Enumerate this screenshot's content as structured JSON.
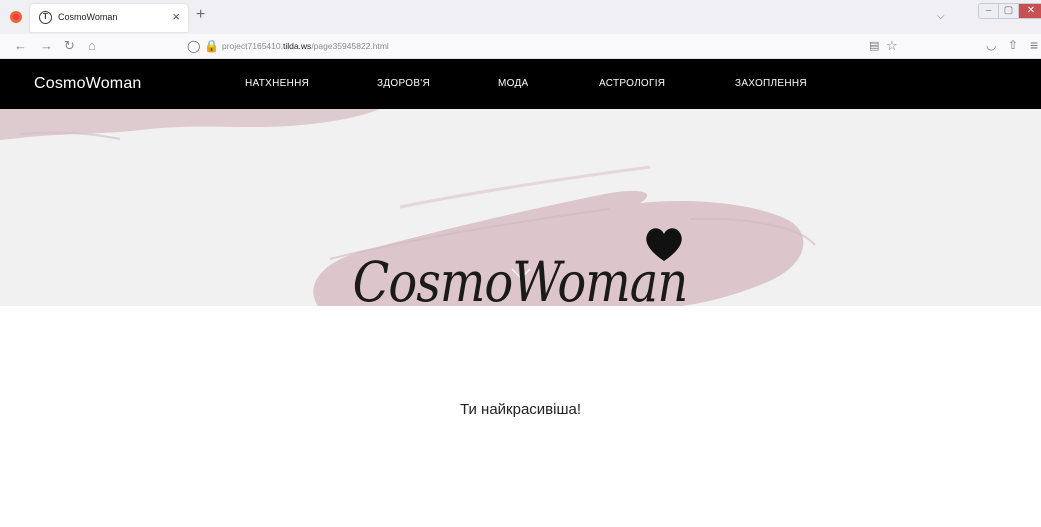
{
  "browser": {
    "tab_title": "CosmoWoman",
    "tab_favicon_glyph": "T",
    "tab_close_glyph": "×",
    "new_tab_glyph": "+",
    "tabs_menu_glyph": "⌵",
    "url_prefix": "project7165410.",
    "url_host": "tilda.ws",
    "url_path": "/page35945822.html",
    "icons": {
      "back": "←",
      "forward": "→",
      "reload": "↻",
      "home": "⌂",
      "shield": "◯",
      "lock": "🔒",
      "reader": "▤",
      "star": "☆",
      "pocket": "◡",
      "extensions": "⇧",
      "menu": "≡"
    },
    "window_controls": {
      "minimize": "–",
      "maximize": "▢",
      "close": "✕"
    }
  },
  "site": {
    "logo": "CosmoWoman",
    "menu": [
      "НАТХНЕННЯ",
      "ЗДОРОВ'Я",
      "МОДА",
      "АСТРОЛОГІЯ",
      "ЗАХОПЛЕННЯ"
    ],
    "hero_script": "CosmoWoman",
    "heart_icon": "heart-icon",
    "headline": "Ти найкрасивіша!"
  },
  "colors": {
    "header_bg": "#000000",
    "hero_bg": "#f1f1f1",
    "brush": "#dcc6cb",
    "accent_heart": "#111111"
  }
}
